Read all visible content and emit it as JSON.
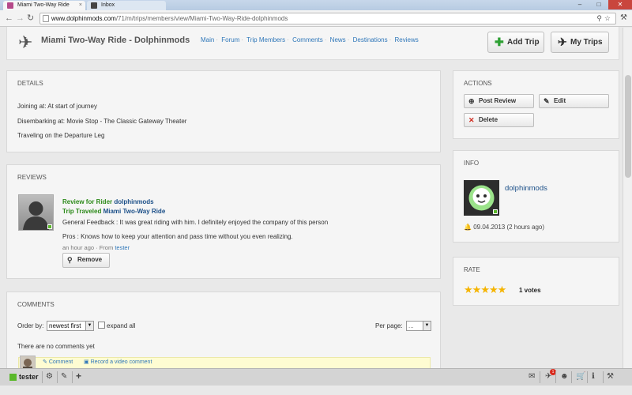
{
  "browser": {
    "tabs": [
      {
        "label": "Miami Two-Way Ride"
      },
      {
        "label": "Inbox"
      }
    ],
    "url_domain": "www.dolphinmods.com",
    "url_path": "/71/m/trips/members/view/Miami-Two-Way-Ride-dolphinmods"
  },
  "header": {
    "title": "Miami Two-Way Ride - Dolphinmods",
    "nav": [
      "Main",
      "Forum",
      "Trip Members",
      "Comments",
      "News",
      "Destinations",
      "Reviews"
    ],
    "add_trip": "Add Trip",
    "my_trips": "My Trips"
  },
  "details": {
    "heading": "DETAILS",
    "joining": "Joining at: At start of journey",
    "disembarking": "Disembarking at: Movie Stop - The Classic Gateway Theater",
    "traveling": "Traveling on the Departure Leg"
  },
  "reviews": {
    "heading": "REVIEWS",
    "item": {
      "review_for_label": "Review for Rider",
      "rider": "dolphinmods",
      "trip_label": "Trip Traveled",
      "trip": "Miami Two-Way Ride",
      "feedback": "General Feedback : It was great riding with him. I definitely enjoyed the company of this person",
      "pros": "Pros : Knows how to keep your attention and pass time without you even realizing.",
      "time": "an hour ago",
      "from_label": "· From",
      "from_user": "tester",
      "remove": "Remove"
    }
  },
  "comments": {
    "heading": "COMMENTS",
    "order_label": "Order by:",
    "order_value": "newest first",
    "expand_all": "expand all",
    "per_page_label": "Per page:",
    "per_page_value": "...",
    "empty": "There are no comments yet",
    "comment_link": "Comment",
    "video_link": "Record a video comment"
  },
  "actions": {
    "heading": "ACTIONS",
    "post_review": "Post Review",
    "edit": "Edit",
    "delete": "Delete"
  },
  "info": {
    "heading": "INFO",
    "username": "dolphinmods",
    "date": "09.04.2013 (2 hours ago)"
  },
  "rate": {
    "heading": "RATE",
    "stars": 5,
    "votes": "1 votes",
    "star_color": "#f5b400"
  },
  "bottombar": {
    "user": "tester",
    "notifications": "1"
  },
  "colors": {
    "link": "#2f77b9",
    "green": "#2d8a1a",
    "accent_green": "#5ab82a"
  }
}
